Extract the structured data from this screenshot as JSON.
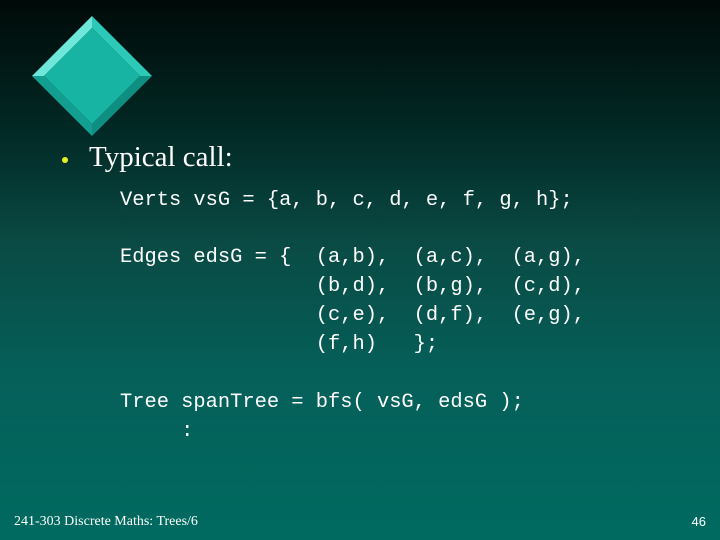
{
  "slide": {
    "heading": "Typical call:",
    "code": {
      "verts_line": "Verts vsG = {a, b, c, d, e, f, g, h};",
      "edges_lines": [
        "Edges edsG = {  (a,b),  (a,c),  (a,g),",
        "                (b,d),  (b,g),  (c,d),",
        "                (c,e),  (d,f),  (e,g),",
        "                (f,h)   };"
      ],
      "tree_line": "Tree spanTree = bfs( vsG, edsG );",
      "ellipsis_line": "     :"
    },
    "footer": {
      "course": "241-303 Discrete Maths: Trees/6",
      "page_number": "46"
    }
  },
  "colors": {
    "diamond_face": "#17b3a3",
    "diamond_light": "#6fe6da",
    "diamond_dark": "#0d8a7e",
    "bullet": "#e8f020",
    "text": "#ffffff"
  },
  "icons": {
    "logo": "teal-diamond-icon",
    "bullet": "bullet-dot-icon"
  }
}
